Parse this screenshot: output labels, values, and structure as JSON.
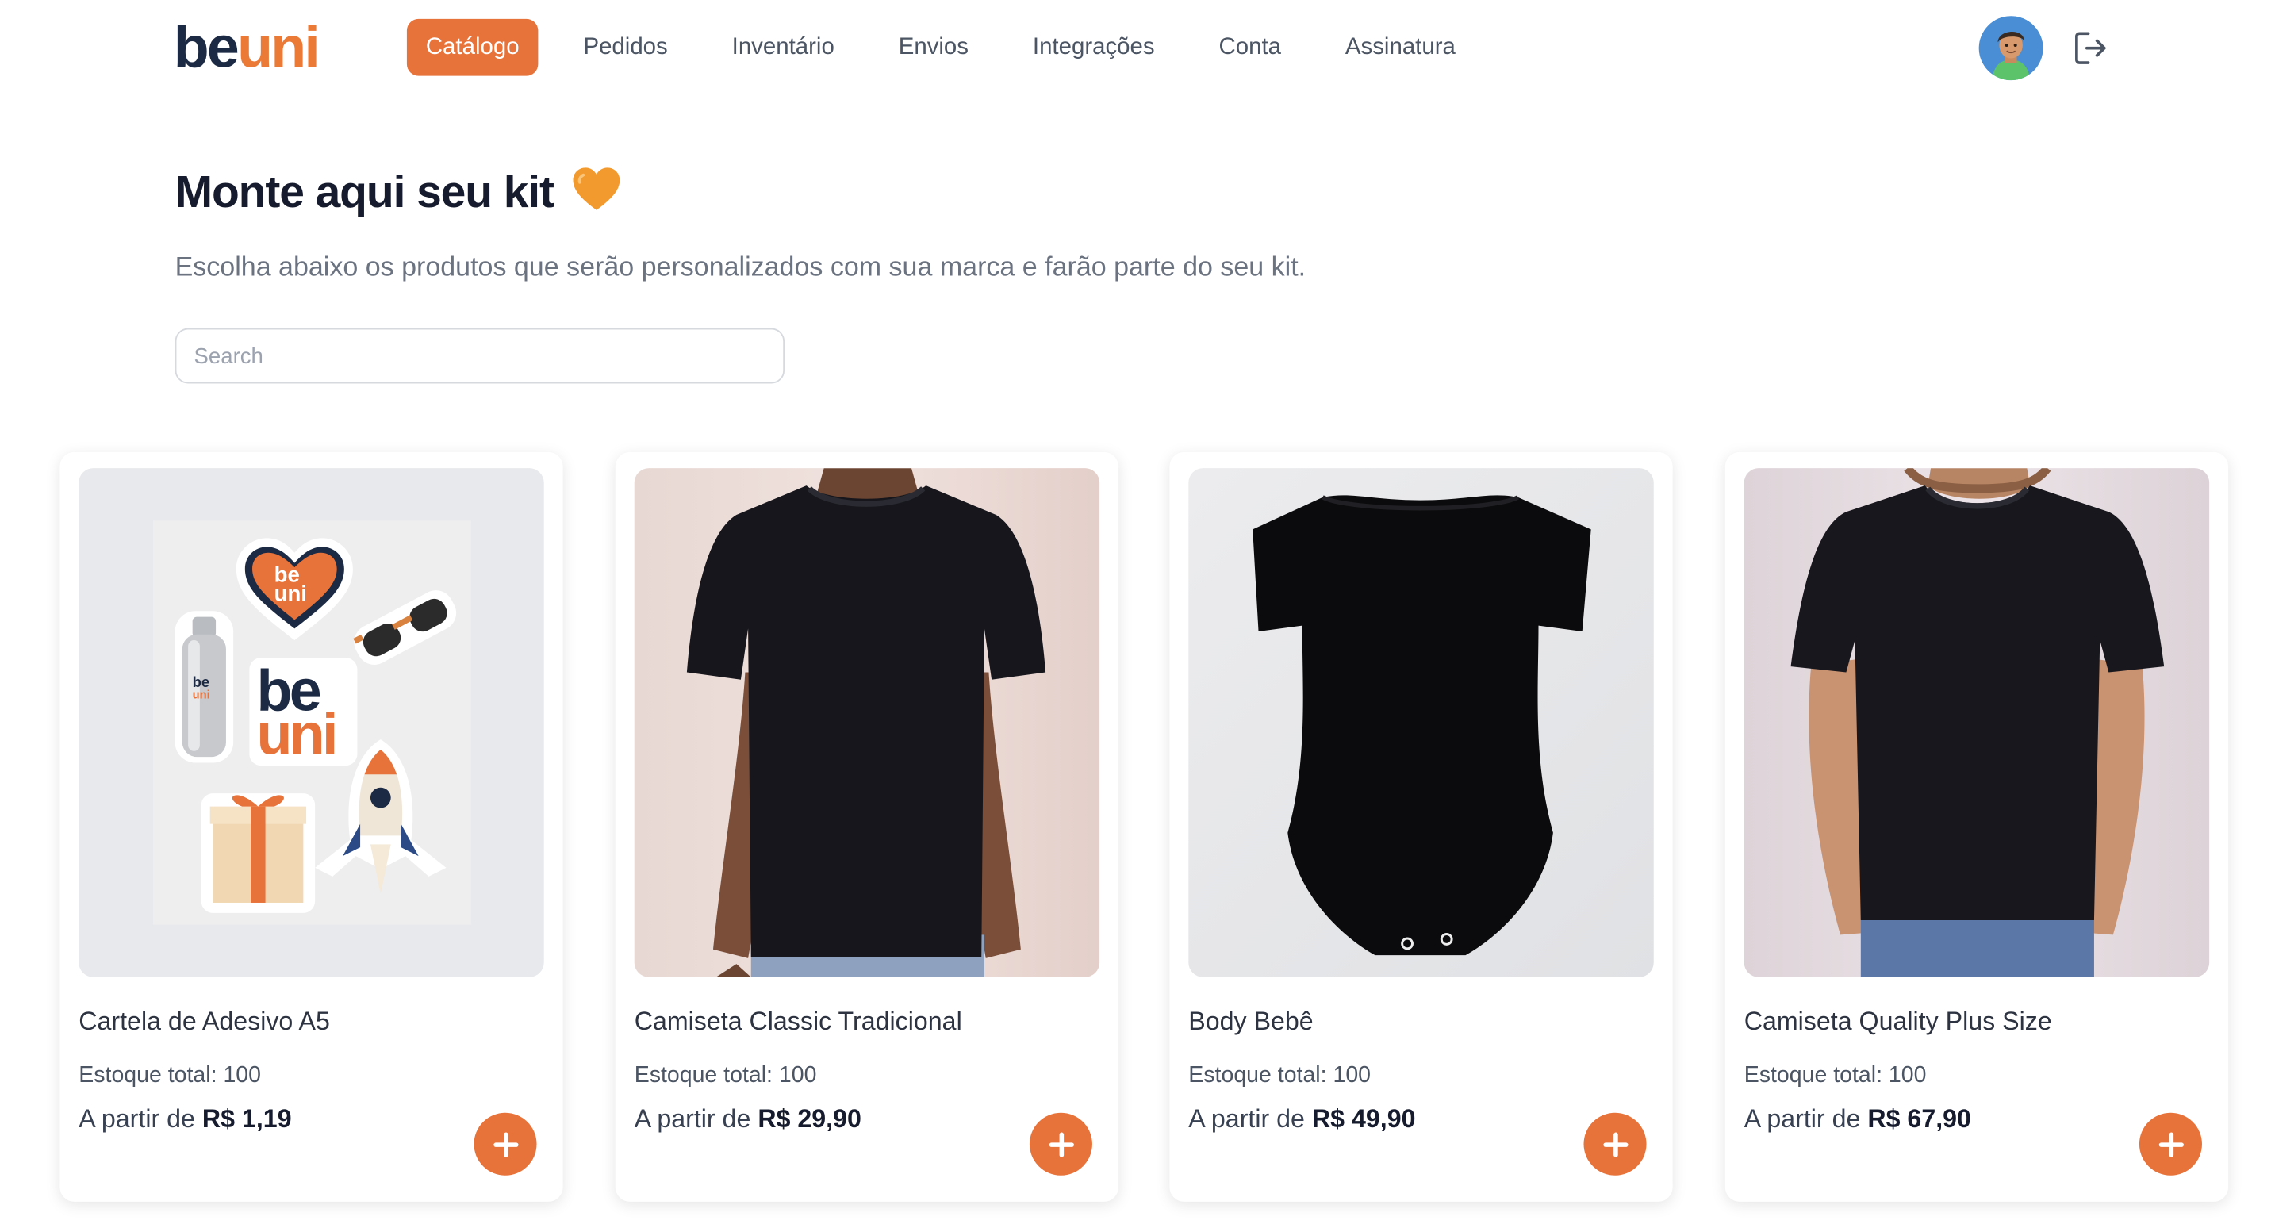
{
  "brand": {
    "logo_be": "be",
    "logo_uni": "uni",
    "primary_color": "#e8733a",
    "navy": "#1c2a44"
  },
  "nav": {
    "items": [
      {
        "label": "Catálogo",
        "active": true
      },
      {
        "label": "Pedidos"
      },
      {
        "label": "Inventário"
      },
      {
        "label": "Envios"
      },
      {
        "label": "Integrações"
      },
      {
        "label": "Conta"
      },
      {
        "label": "Assinatura"
      }
    ],
    "avatar_icon": "user-avatar",
    "logout_icon": "logout-icon"
  },
  "hero": {
    "title": "Monte aqui seu kit",
    "title_emoji": "🧡",
    "subtitle": "Escolha abaixo os produtos que serão personalizados com sua marca e farão parte do seu kit."
  },
  "search": {
    "placeholder": "Search",
    "value": ""
  },
  "products": [
    {
      "name": "Cartela de Adesivo A5",
      "stock_label": "Estoque total: 100",
      "price_prefix": "A partir de",
      "price": "R$ 1,19",
      "image": "sticker-sheet"
    },
    {
      "name": "Camiseta Classic Tradicional",
      "stock_label": "Estoque total: 100",
      "price_prefix": "A partir de",
      "price": "R$ 29,90",
      "image": "tshirt-model"
    },
    {
      "name": "Body Bebê",
      "stock_label": "Estoque total: 100",
      "price_prefix": "A partir de",
      "price": "R$ 49,90",
      "image": "baby-bodysuit"
    },
    {
      "name": "Camiseta Quality Plus Size",
      "stock_label": "Estoque total: 100",
      "price_prefix": "A partir de",
      "price": "R$ 67,90",
      "image": "tshirt-model-plus"
    }
  ],
  "sticker_texts": {
    "heart_be": "be",
    "heart_uni": "uni",
    "big_be": "be",
    "big_uni": "uni"
  },
  "add_button_icon": "plus-icon"
}
